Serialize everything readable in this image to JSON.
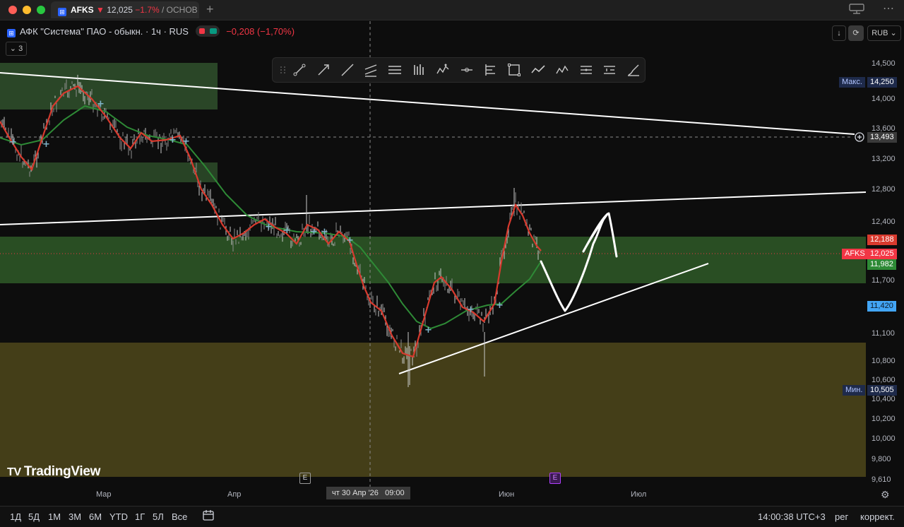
{
  "window": {
    "tab_symbol": "AFKS",
    "tab_price": "12,025",
    "tab_change": "−1.7%",
    "tab_name": "/ ОСНОВ",
    "tab_badge": "AFKS"
  },
  "legend": {
    "title": "АФК \"Система\" ПАО - обыкн. · 1ч · RUS",
    "change": "−0,208 (−1,70%)",
    "collapse_count": "3",
    "badge": "AFKS"
  },
  "colors": {
    "accent": "#2962ff",
    "down": "#f23645",
    "up": "#089981",
    "zone_green": "#2f5a28",
    "zone_olive": "#4a441a",
    "ema_fast": "#d83a2e",
    "ema_slow": "#2e8a36"
  },
  "toolbar_icons": [
    "trendline-icon",
    "ray-icon",
    "extended-line-icon",
    "parallel-channel-icon",
    "horizontal-lines-icon",
    "vertical-lines-icon",
    "xabcd-pattern-icon",
    "cross-line-icon",
    "fib-icon",
    "rectangle-icon",
    "path-icon",
    "abcd-pattern-icon",
    "fib-channel-icon",
    "long-position-icon",
    "brush-icon"
  ],
  "top_right": {
    "currency": "RUB",
    "download_icon": "download-icon",
    "sync_icon": "sync-icon"
  },
  "price_axis": {
    "labels": [
      "14,500",
      "14,000",
      "13,600",
      "13,200",
      "12,800",
      "12,400",
      "11,700",
      "11,100",
      "10,800",
      "10,600",
      "10,400",
      "10,200",
      "10,000",
      "9,800",
      "9,610"
    ],
    "max_label": "Макс.",
    "max_value": "14,250",
    "crosshair_value": "13,493",
    "tag_red": "12,188",
    "symbol_tag": "AFKS",
    "current_price": "12,025",
    "tag_green": "11,982",
    "tag_blue": "11,420",
    "min_label": "Мин.",
    "min_value": "10,505"
  },
  "time_axis": {
    "labels": [
      "Мар",
      "Апр",
      "Июн",
      "Июл"
    ],
    "crosshair_time": "чт 30 Апр '26   09:00",
    "earnings_marker": "E"
  },
  "watermark": "TradingView",
  "bottom": {
    "ranges": [
      "1Д",
      "5Д",
      "1М",
      "3М",
      "6М",
      "YTD",
      "1Г",
      "5Л",
      "Все"
    ],
    "clock": "14:00:38 UTC+3",
    "session": "рег",
    "adjust": "коррект."
  }
}
